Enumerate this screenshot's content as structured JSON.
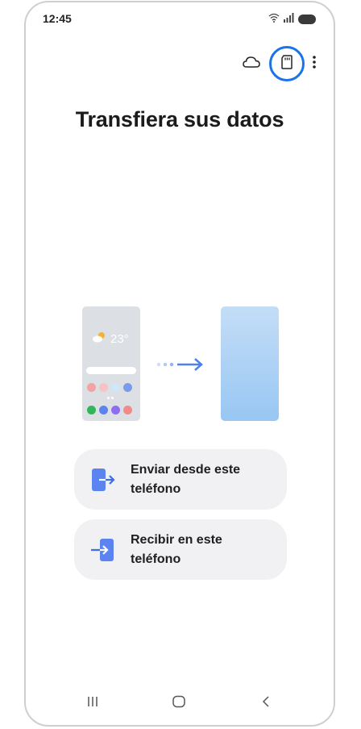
{
  "status_bar": {
    "time": "12:45",
    "icons": [
      "wifi-icon",
      "signal-icon",
      "battery-icon"
    ]
  },
  "top_actions": [
    {
      "name": "cloud-icon"
    },
    {
      "name": "sd-card-icon",
      "highlighted": true,
      "highlight_color": "#1a73e8"
    },
    {
      "name": "more-options-icon"
    }
  ],
  "title": "Transfiera sus datos",
  "illustration": {
    "weather_temp": "23°",
    "app_colors": [
      "#f2a3a3",
      "#f7c3c3",
      "#cfe7f6",
      "#7a9af0",
      "#33b65a",
      "#5b84f0",
      "#8e6ef0",
      "#f28a8a"
    ]
  },
  "options": [
    {
      "label": "Enviar desde este teléfono",
      "icon": "send-phone-icon"
    },
    {
      "label": "Recibir en este teléfono",
      "icon": "receive-phone-icon"
    }
  ],
  "nav_bar": {
    "items": [
      "recents-icon",
      "home-icon",
      "back-icon"
    ]
  },
  "colors": {
    "accent": "#1a73e8",
    "card_bg": "#f1f1f3",
    "icon_blue": "#5b84f0"
  }
}
